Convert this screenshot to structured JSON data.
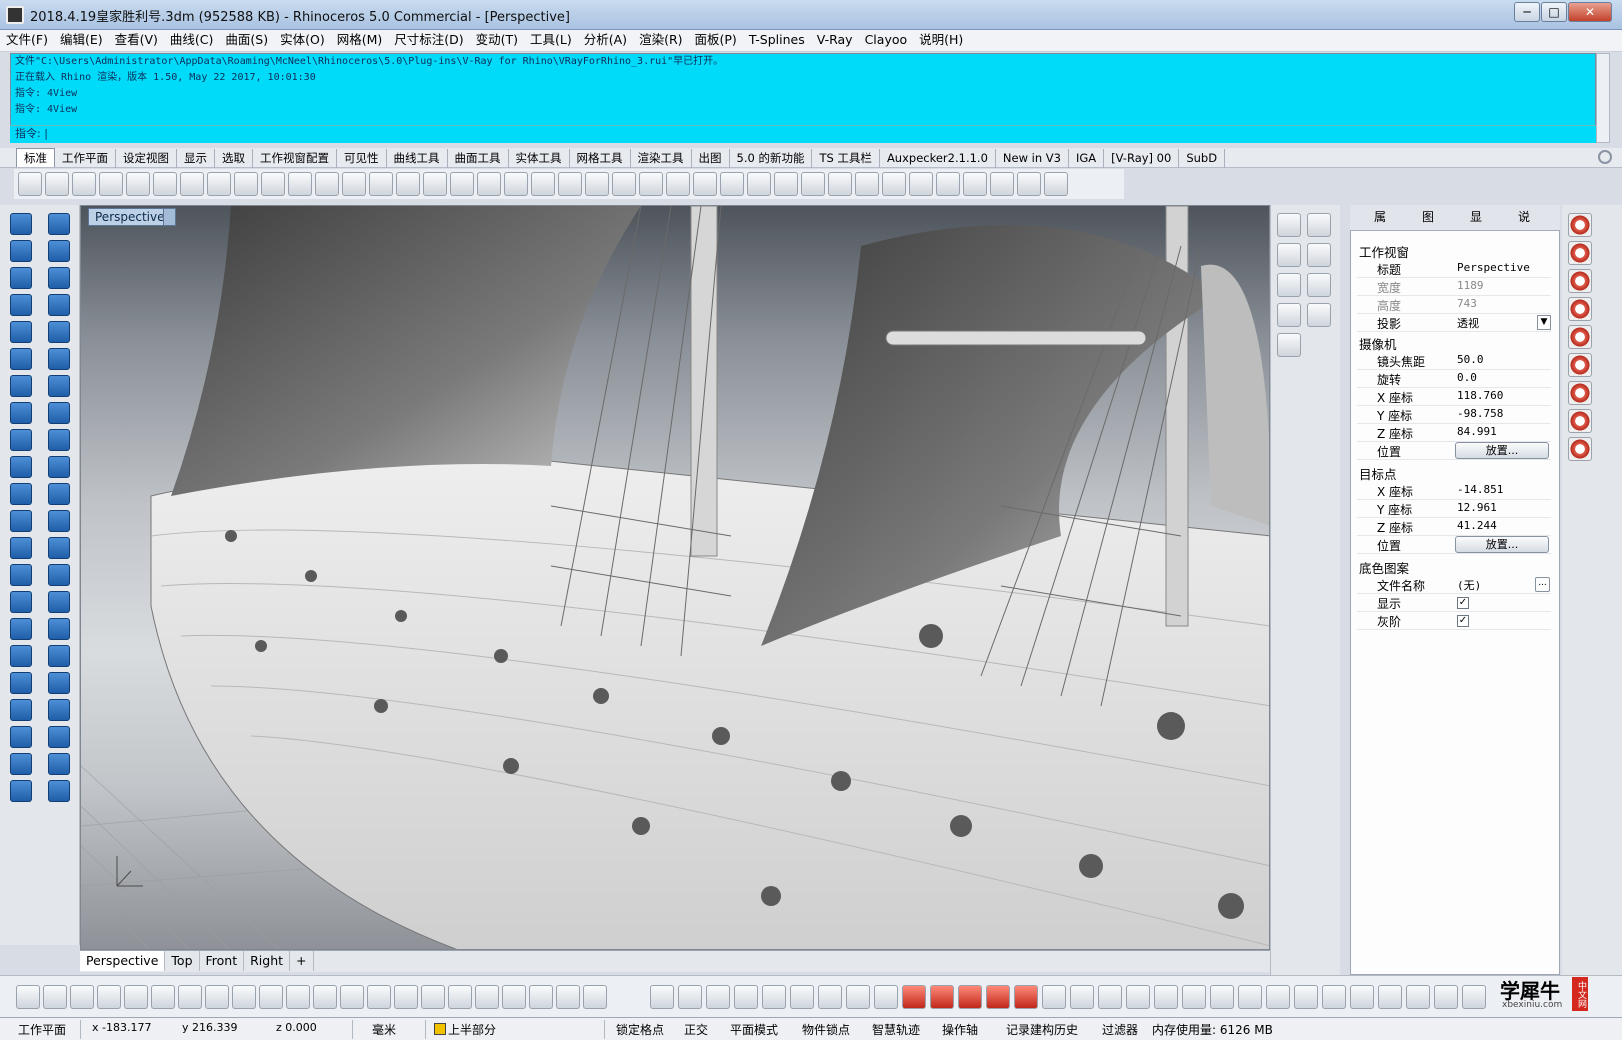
{
  "window": {
    "title": "2018.4.19皇家胜利号.3dm (952588 KB) - Rhinoceros 5.0 Commercial - [Perspective]",
    "minimize": "─",
    "maximize": "□",
    "close": "✕"
  },
  "menu": [
    "文件(F)",
    "编辑(E)",
    "查看(V)",
    "曲线(C)",
    "曲面(S)",
    "实体(O)",
    "网格(M)",
    "尺寸标注(D)",
    "变动(T)",
    "工具(L)",
    "分析(A)",
    "渲染(R)",
    "面板(P)",
    "T-Splines",
    "V-Ray",
    "Clayoo",
    "说明(H)"
  ],
  "command_history": [
    "文件\"C:\\Users\\Administrator\\AppData\\Roaming\\McNeel\\Rhinoceros\\5.0\\Plug-ins\\V-Ray for Rhino\\VRayForRhino_3.rui\"早已打开。",
    "正在载入 Rhino 渲染，版本 1.50, May 22 2017, 10:01:30",
    "指令: 4View",
    "指令: 4View"
  ],
  "command_prompt": "指令: |",
  "toolbar_tabs": [
    "标准",
    "工作平面",
    "设定视图",
    "显示",
    "选取",
    "工作视窗配置",
    "可见性",
    "曲线工具",
    "曲面工具",
    "实体工具",
    "网格工具",
    "渲染工具",
    "出图",
    "5.0 的新功能",
    "TS 工具栏",
    "Auxpecker2.1.1.0",
    "New in V3",
    "IGA",
    "[V-Ray] 00",
    "SubD"
  ],
  "viewport": {
    "active_label": "Perspective",
    "tabs": [
      "Perspective",
      "Top",
      "Front",
      "Right",
      "+"
    ]
  },
  "panel": {
    "tabs": [
      "属",
      "图",
      "显",
      "说"
    ],
    "sections": {
      "viewport": "工作视窗",
      "camera": "摄像机",
      "target": "目标点",
      "background": "底色图案"
    },
    "viewport_rows": [
      {
        "k": "标题",
        "v": "Perspective"
      },
      {
        "k": "宽度",
        "v": "1189"
      },
      {
        "k": "高度",
        "v": "743"
      },
      {
        "k": "投影",
        "v": "透视"
      }
    ],
    "camera_rows": [
      {
        "k": "镜头焦距",
        "v": "50.0"
      },
      {
        "k": "旋转",
        "v": "0.0"
      },
      {
        "k": "X 座标",
        "v": "118.760"
      },
      {
        "k": "Y 座标",
        "v": "-98.758"
      },
      {
        "k": "Z 座标",
        "v": "84.991"
      },
      {
        "k": "位置",
        "v": "放置..."
      }
    ],
    "target_rows": [
      {
        "k": "X 座标",
        "v": "-14.851"
      },
      {
        "k": "Y 座标",
        "v": "12.961"
      },
      {
        "k": "Z 座标",
        "v": "41.244"
      },
      {
        "k": "位置",
        "v": "放置..."
      }
    ],
    "background_rows": [
      {
        "k": "文件名称",
        "v": "(无)"
      },
      {
        "k": "显示",
        "v": "✓"
      },
      {
        "k": "灰阶",
        "v": "✓"
      }
    ]
  },
  "status": {
    "plane": "工作平面",
    "x": "x -183.177",
    "y": "y 216.339",
    "z": "z 0.000",
    "unit": "毫米",
    "layer": "上半部分",
    "grid_snap": "锁定格点",
    "ortho": "正交",
    "planar": "平面模式",
    "osnap": "物件锁点",
    "smarttrack": "智慧轨迹",
    "gumball": "操作轴",
    "history": "记录建构历史",
    "filter": "过滤器",
    "memory": "内存使用量: 6126 MB"
  },
  "logo": {
    "main": "学犀牛",
    "sub": "xbexiniu.com",
    "badge": "中文网"
  }
}
